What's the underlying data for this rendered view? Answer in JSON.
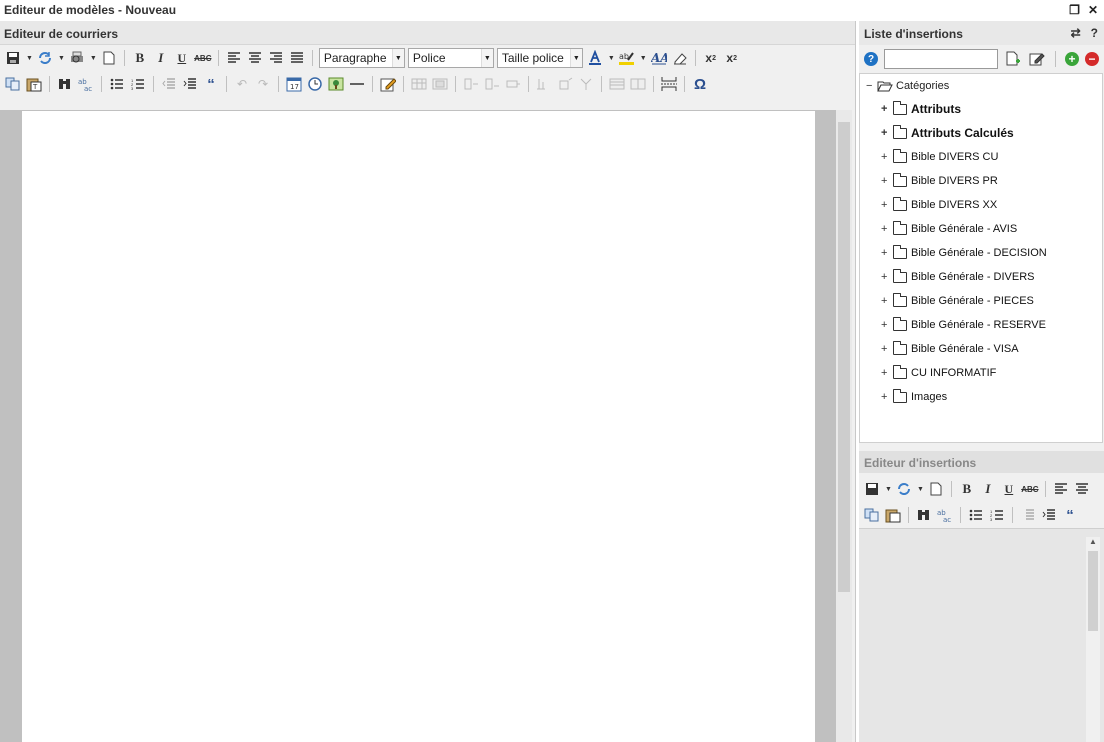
{
  "window": {
    "title": "Editeur de modèles - Nouveau"
  },
  "left_pane": {
    "header": "Editeur de courriers",
    "toolbar": {
      "paragraph_select": "Paragraphe",
      "font_select": "Police",
      "size_select": "Taille police",
      "bold": "B",
      "italic": "I",
      "underline": "U",
      "strike": "ABC",
      "omega": "Ω"
    }
  },
  "right_pane": {
    "header": "Liste d'insertions",
    "search_value": "",
    "tree": {
      "root_label": "Catégories",
      "items": [
        {
          "label": "Attributs",
          "bold": true
        },
        {
          "label": "Attributs Calculés",
          "bold": true
        },
        {
          "label": "Bible DIVERS CU"
        },
        {
          "label": "Bible DIVERS PR"
        },
        {
          "label": "Bible DIVERS XX"
        },
        {
          "label": "Bible Générale - AVIS"
        },
        {
          "label": "Bible Générale - DECISION"
        },
        {
          "label": "Bible Générale - DIVERS"
        },
        {
          "label": "Bible Générale - PIECES"
        },
        {
          "label": "Bible Générale - RESERVE"
        },
        {
          "label": "Bible Générale - VISA"
        },
        {
          "label": "CU INFORMATIF"
        },
        {
          "label": "Images"
        }
      ]
    },
    "insert_editor": {
      "header": "Editeur d'insertions"
    }
  },
  "colors": {
    "help_blue": "#1f72c4",
    "add_green": "#3aa53a",
    "remove_red": "#d42a2a"
  }
}
